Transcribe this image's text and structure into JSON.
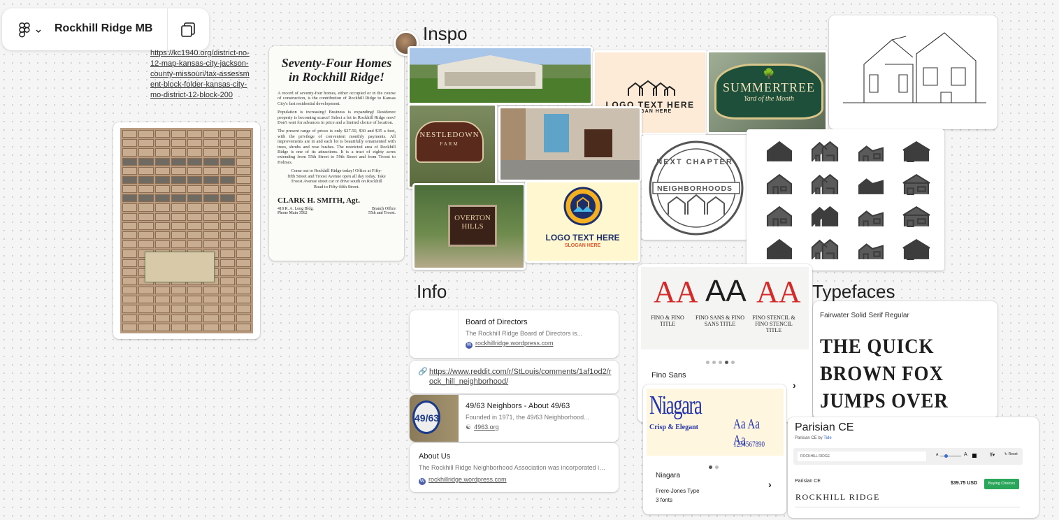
{
  "toolbar": {
    "file_title": "Rockhill Ridge MB",
    "figma_icon": "figma-logo-icon",
    "menu_icon": "chevron-down-icon",
    "pages_icon": "pages-icon"
  },
  "top_link": "https://kc1940.org/district-no-12-map-kansas-city-jackson-county-missouri/tax-assessment-block-folder-kansas-city-mo-district-12-block-200",
  "sections": {
    "inspo": "Inspo",
    "info": "Info",
    "typefaces": "Typefaces"
  },
  "newspaper": {
    "title": "Seventy-Four Homes in Rockhill Ridge!",
    "body1": "A record of seventy-four homes, either occupied or in the course of construction, is the contribution of Rockhill Ridge to Kansas City's fast residential development.",
    "body2": "Population is increasing! Business is expanding! Residence property is becoming scarce! Select a lot in Rockhill Ridge now! Don't wait for advances in price and a limited choice of location.",
    "body3": "The present range of prices is only $27.50, $30 and $35 a foot, with the privilege of convenient monthly payments. All improvements are in and each lot is beautifully ornamented with trees, shrubs and rose bushes. The restricted area of Rockhill Ridge is one of its attractions. It is a tract of eighty acres extending from 55th Street to 59th Street and from Troost to Holmes.",
    "body4": "Come out to Rockhill Ridge today! Office at Fifty-fifth Street and Troost Avenue open all day today. Take Troost Avenue street car or drive south on Rockhill Road to Fifty-fifth Street.",
    "signature": "CLARK H. SMITH, Agt.",
    "addr_left": "418 R. A. Long Bldg.\nPhone Main 3562",
    "addr_right": "Branch Office\n55th and Troost."
  },
  "inspo_images": {
    "logo1_text": "LOGO TEXT HERE",
    "logo1_sub": "SLOGAN HERE",
    "summertree_1": "SUMMERTREE",
    "summertree_2": "Yard of the Month",
    "nestledown_1": "NESTLEDOWN",
    "nestledown_2": "FARM",
    "next_chapter_1": "NEXT CHAPTER",
    "next_chapter_2": "NEIGHBORHOODS",
    "overton_1": "OVERTON",
    "overton_2": "HILLS",
    "logo2_text": "LOGO TEXT HERE",
    "logo2_sub": "SLOGAN HERE"
  },
  "info": [
    {
      "title": "Board of Directors",
      "desc": "The Rockhill Ridge Board of Directors is...",
      "link": "rockhillridge.wordpress.com"
    },
    {
      "url": "https://www.reddit.com/r/StLouis/comments/1af1od2/rock_hill_neighborhood/"
    },
    {
      "title": "49/63 Neighbors - About 49/63",
      "desc": "Founded in 1971, the 49/63 Neighborhood...",
      "link": "4963.org",
      "thumb": "49/63"
    },
    {
      "title": "About Us",
      "desc": "The Rockhill Ridge Neighborhood Association was incorporated in 1...",
      "link": "rockhillridge.wordpress.com"
    }
  ],
  "fino": {
    "labels": [
      "FINO & FINO TITLE",
      "FINO SANS & FINO SANS TITLE",
      "FINO STENCIL & FINO STENCIL TITLE"
    ],
    "name": "Fino Sans",
    "glyph": "AA"
  },
  "niagara": {
    "word": "Niagara",
    "tagline": "Crisp & Elegant",
    "samples": "Aa Aa Aa",
    "digits": "1234567890",
    "name": "Niagara",
    "foundry": "Frere-Jones Type",
    "count": "3 fonts"
  },
  "fairwater": {
    "name": "Fairwater Solid Serif Regular",
    "sample": "THE QUICK BROWN FOX JUMPS OVER"
  },
  "parisian": {
    "title": "Parisian CE",
    "by_label": "Parisian CE by",
    "foundry": "Tide",
    "input_value": "ROCKHILL RIDGE",
    "size_small": "A",
    "size_large": "A",
    "reset": "Reset",
    "font_name": "Parisian CE",
    "price": "$39.75 USD",
    "buy": "Buying Choices",
    "preview": "ROCKHILL RIDGE"
  },
  "colors": {
    "buy_green": "#2aa65a",
    "niagara_blue": "#2233a8",
    "fino_red": "#d42a2a"
  }
}
